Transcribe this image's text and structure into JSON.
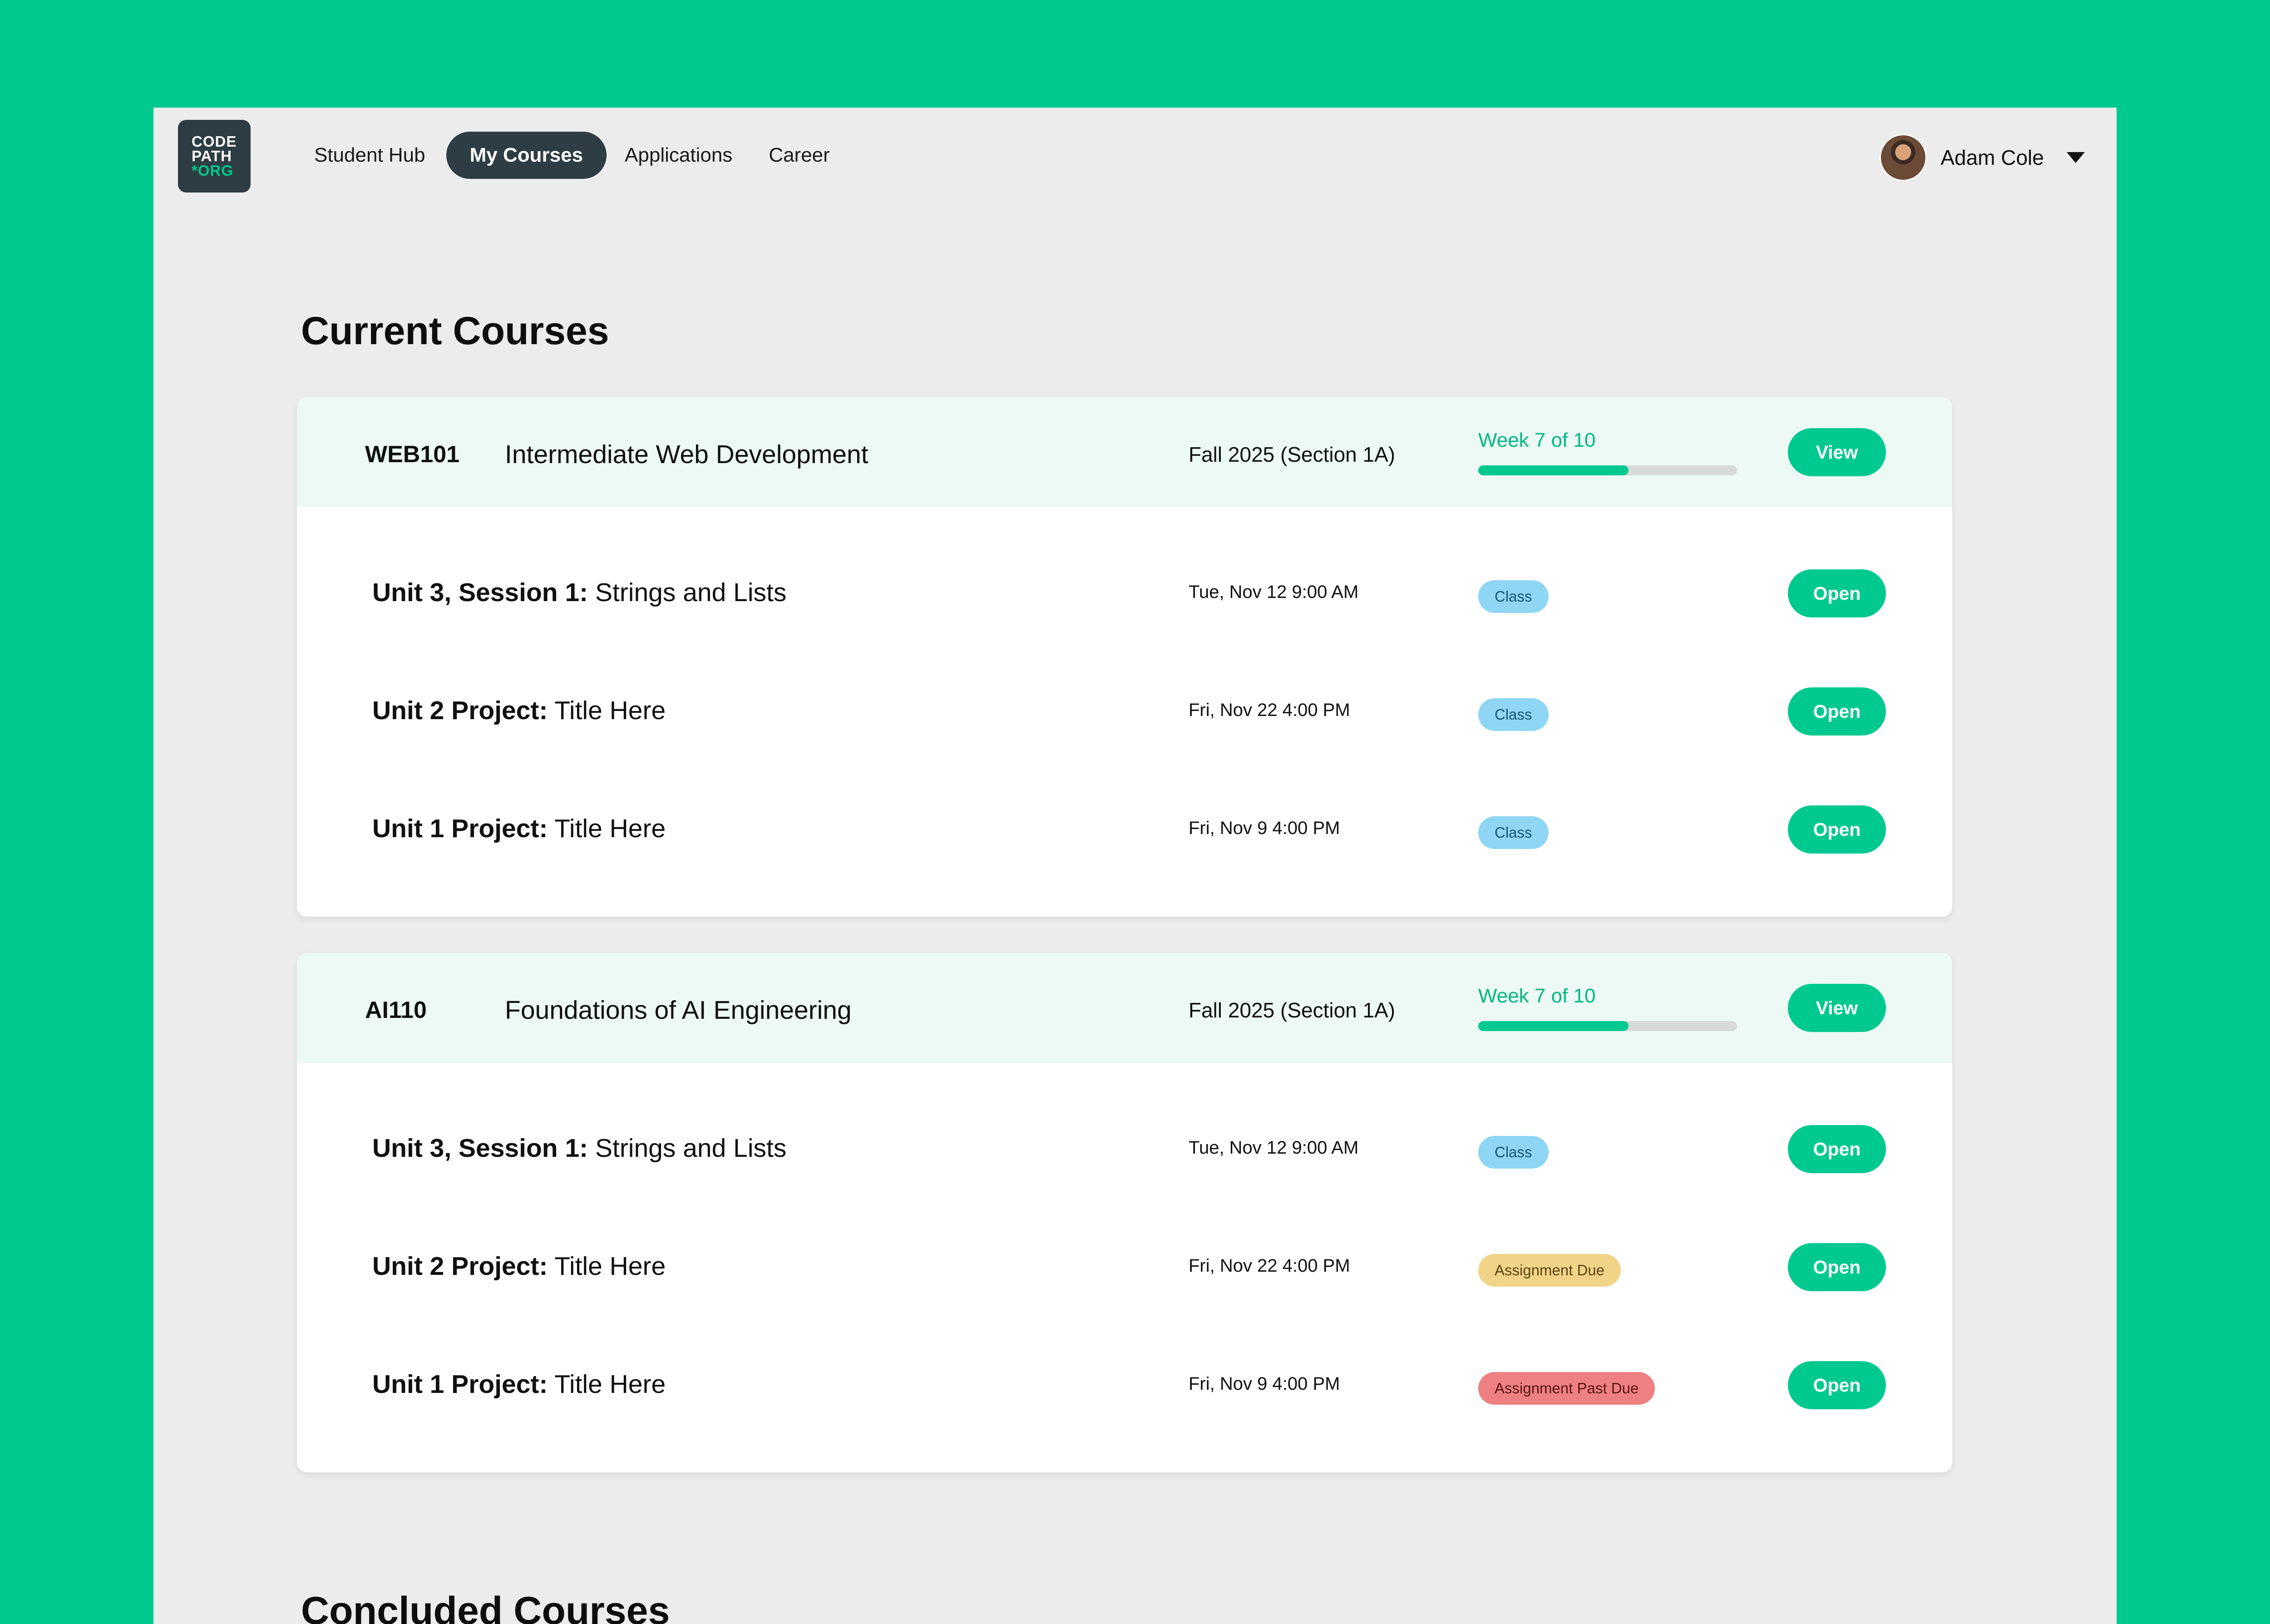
{
  "logo": {
    "line1": "CODE",
    "line2": "PATH",
    "line3": "*ORG"
  },
  "nav": {
    "items": [
      {
        "label": "Student Hub"
      },
      {
        "label": "My Courses"
      },
      {
        "label": "Applications"
      },
      {
        "label": "Career"
      }
    ],
    "active_index": 1
  },
  "user": {
    "name": "Adam Cole"
  },
  "current_title": "Current Courses",
  "concluded_title": "Concluded Courses",
  "colors": {
    "brand_green": "#00C98F",
    "nav_dark": "#2E3D43",
    "class_badge": "#8ED6F4",
    "due_badge": "#F1D488",
    "past_due_badge": "#EE8083"
  },
  "courses": [
    {
      "code": "WEB101",
      "title": "Intermediate Web Development",
      "term": "Fall 2025 (Section 1A)",
      "week": "Week 7 of 10",
      "progress": 0.58,
      "view_label": "View",
      "items": [
        {
          "bold": "Unit 3, Session 1:",
          "title": "Strings and Lists",
          "date": "Tue, Nov 12 9:00 AM",
          "badge": "Class",
          "open_label": "Open"
        },
        {
          "bold": "Unit 2 Project:",
          "title": "Title Here",
          "date": "Fri, Nov 22 4:00 PM",
          "badge": "Class",
          "open_label": "Open"
        },
        {
          "bold": "Unit 1 Project:",
          "title": "Title Here",
          "date": "Fri, Nov 9 4:00 PM",
          "badge": "Class",
          "open_label": "Open"
        }
      ]
    },
    {
      "code": "AI110",
      "title": "Foundations of AI Engineering",
      "term": "Fall 2025 (Section 1A)",
      "week": "Week 7 of 10",
      "progress": 0.58,
      "view_label": "View",
      "items": [
        {
          "bold": "Unit 3, Session 1:",
          "title": "Strings and Lists",
          "date": "Tue, Nov 12 9:00 AM",
          "badge": "Class",
          "open_label": "Open"
        },
        {
          "bold": "Unit 2 Project:",
          "title": "Title Here",
          "date": "Fri, Nov 22 4:00 PM",
          "badge": "Assignment Due",
          "open_label": "Open"
        },
        {
          "bold": "Unit 1 Project:",
          "title": "Title Here",
          "date": "Fri, Nov 9 4:00 PM",
          "badge": "Assignment Past Due",
          "open_label": "Open"
        }
      ]
    }
  ]
}
